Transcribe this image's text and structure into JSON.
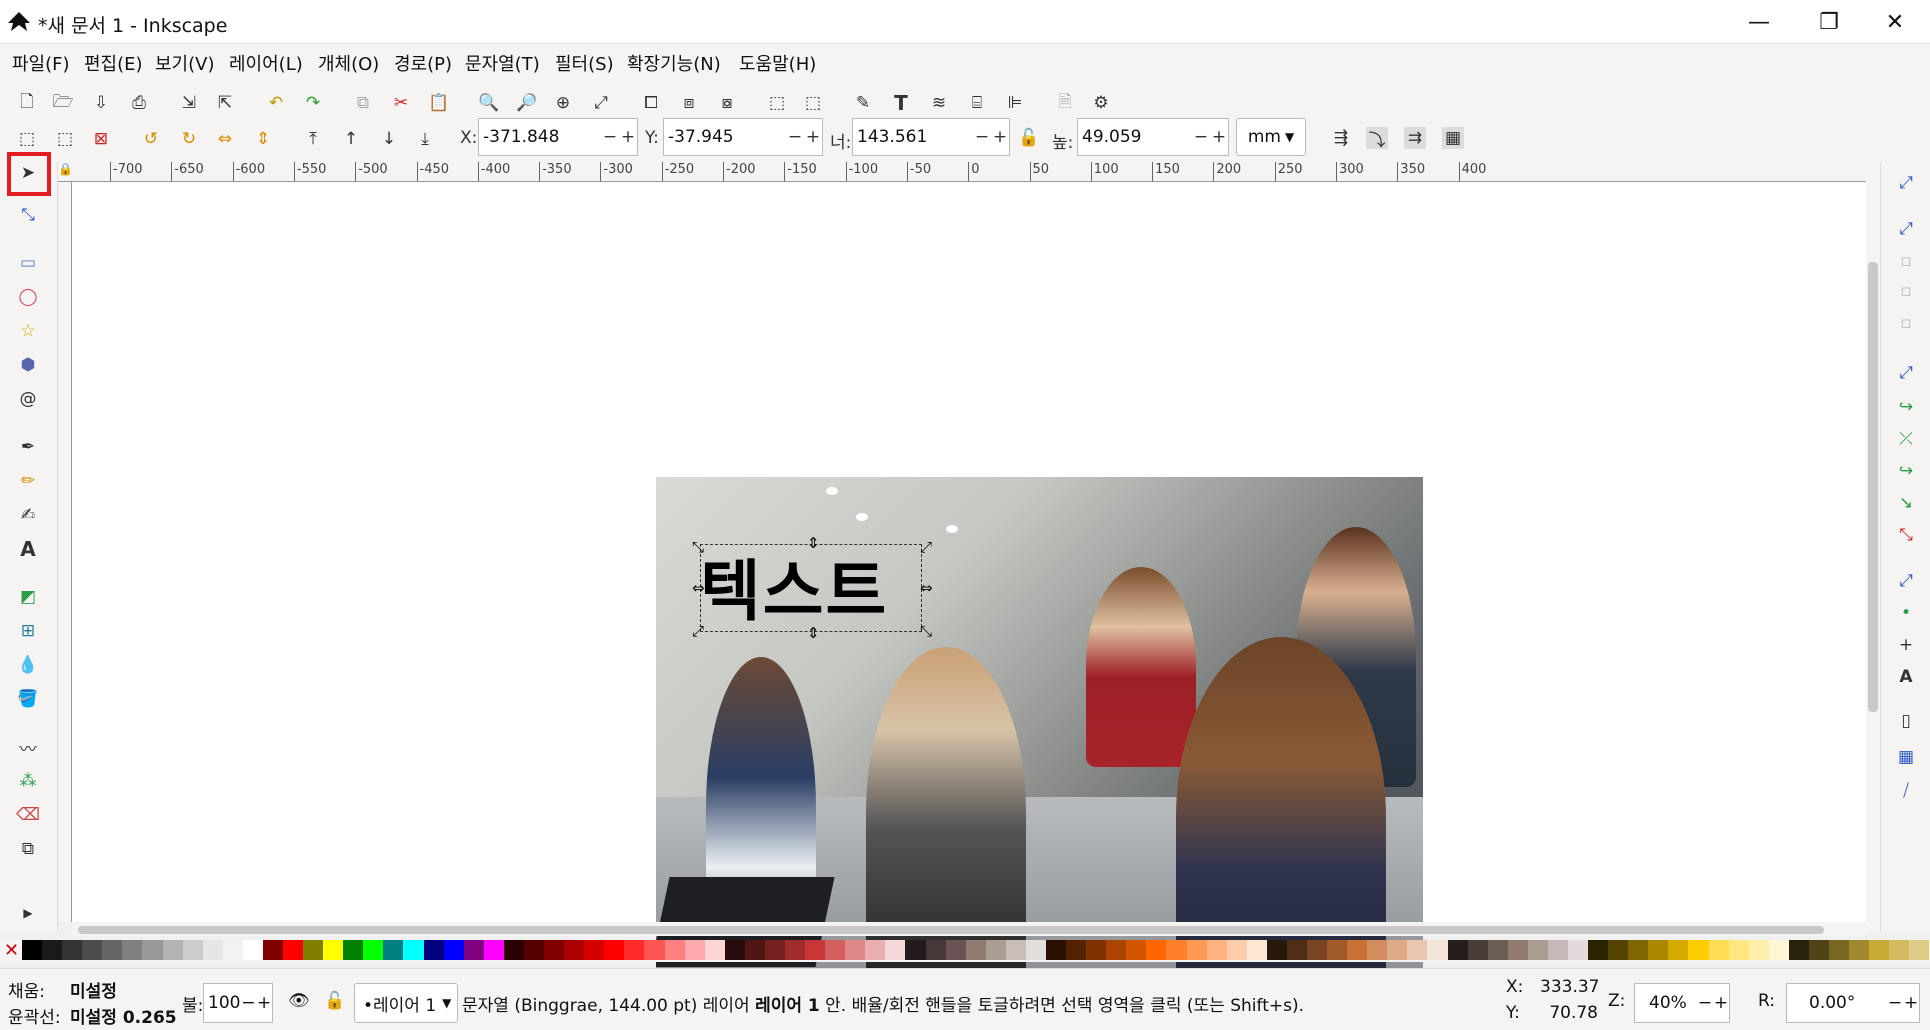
{
  "window": {
    "title": "*새 문서 1 - Inkscape",
    "min_icon": "minimize-icon",
    "max_icon": "restore-icon",
    "close_icon": "close-icon"
  },
  "menu": [
    "파일(F)",
    "편집(E)",
    "보기(V)",
    "레이어(L)",
    "개체(O)",
    "경로(P)",
    "문자열(T)",
    "필터(S)",
    "확장기능(N)",
    "도움말(H)"
  ],
  "toolbar": {
    "x_label": "X:",
    "x_value": "-371.848",
    "y_label": "Y:",
    "y_value": "-37.945",
    "w_label": "너:",
    "w_value": "143.561",
    "h_label": "높:",
    "h_value": "49.059",
    "unit": "mm"
  },
  "ruler_ticks": [
    "-700",
    "-650",
    "-600",
    "-550",
    "-500",
    "-450",
    "-400",
    "-350",
    "-300",
    "-250",
    "-200",
    "-150",
    "-100",
    "-50",
    "0",
    "50",
    "100",
    "150",
    "200",
    "250",
    "300",
    "350",
    "400"
  ],
  "canvas": {
    "text": "텍스트"
  },
  "status": {
    "fill_label": "채움:",
    "fill_value": "미설정",
    "stroke_label": "윤곽선:",
    "stroke_value": "미설정 0.265",
    "opacity_label": "불:",
    "opacity_value": "100",
    "layer_value": "•레이어 1",
    "message_a": "문자열  (Binggrae, 144.00 pt) 레이어 ",
    "message_b": "레이어 1",
    "message_c": " 안. 배율/회전 핸들을 토글하려면 선택 영역을 클릭 (또는 Shift+s).",
    "cx_label": "X:",
    "cx_value": "333.37",
    "cy_label": "Y:",
    "cy_value": "70.78",
    "zoom_label": "Z:",
    "zoom_value": "40%",
    "rot_label": "R:",
    "rot_value": "0.00°"
  },
  "colors": {
    "selection_highlight": "#e31c23",
    "accent": "#4a6fb5"
  }
}
